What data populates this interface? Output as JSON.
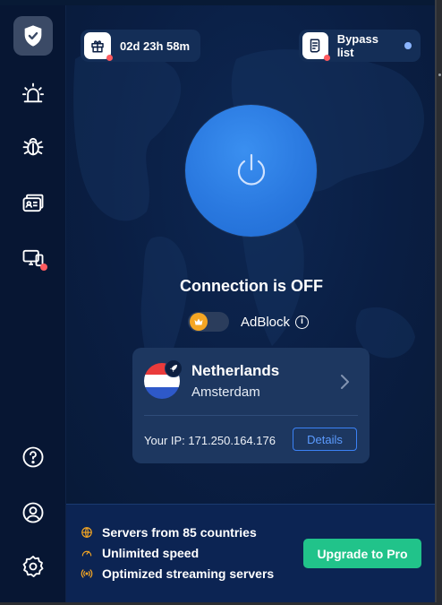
{
  "timer": {
    "label": "02d 23h 58m",
    "icon": "gift-icon"
  },
  "bypass": {
    "label": "Bypass list",
    "icon": "list-icon"
  },
  "status": {
    "text": "Connection is OFF"
  },
  "adblock": {
    "label": "AdBlock",
    "info_glyph": "i",
    "enabled": false,
    "knob_icon": "crown-icon"
  },
  "location": {
    "country": "Netherlands",
    "city": "Amsterdam",
    "ip_text": "Your IP: 171.250.164.176",
    "details_label": "Details",
    "flag_colors": [
      "#ea3b3b",
      "#ffffff",
      "#2e59c9"
    ]
  },
  "promo": {
    "features": [
      {
        "label": "Servers from 85 countries",
        "icon": "globe-icon"
      },
      {
        "label": "Unlimited speed",
        "icon": "speedometer-icon"
      },
      {
        "label": "Optimized streaming servers",
        "icon": "broadcast-icon"
      }
    ],
    "cta_label": "Upgrade to Pro"
  },
  "sidebar": {
    "items": [
      {
        "name": "shield-icon",
        "active": true
      },
      {
        "name": "alarm-icon"
      },
      {
        "name": "bug-icon"
      },
      {
        "name": "id-cards-icon"
      },
      {
        "name": "devices-icon",
        "badge": true
      },
      {
        "name": "help-icon"
      },
      {
        "name": "account-icon"
      },
      {
        "name": "settings-icon"
      }
    ]
  },
  "colors": {
    "background": "#081a35",
    "power_button": "#2a79e0",
    "accent_green": "#21c38a",
    "accent_orange": "#f5a623",
    "badge_red": "#ff5a5f"
  }
}
